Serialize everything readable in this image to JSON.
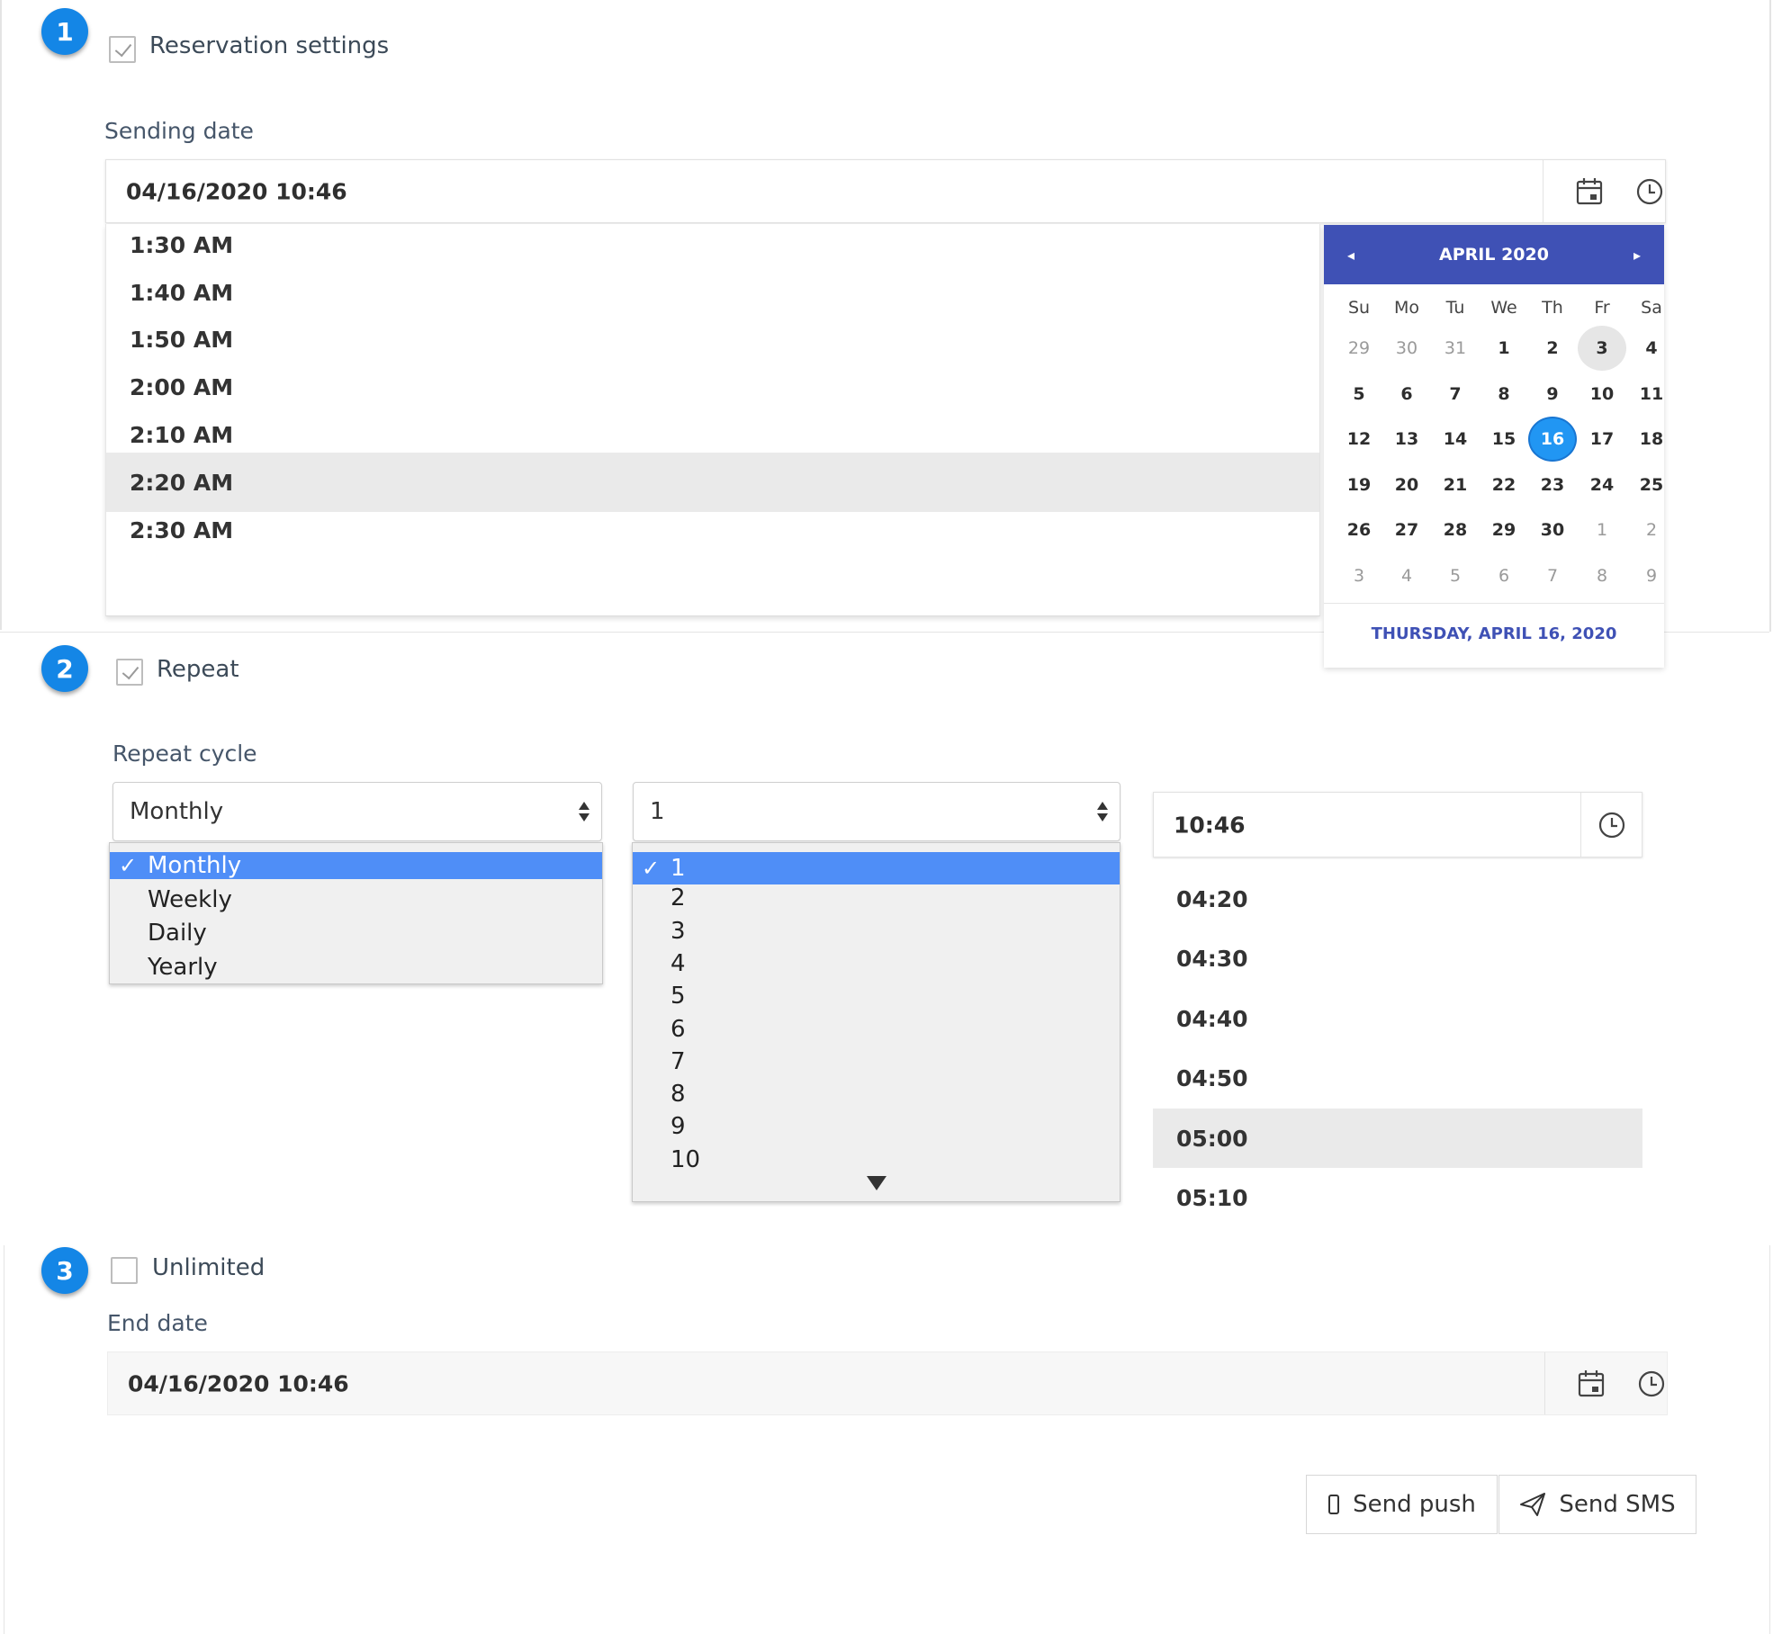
{
  "steps": {
    "one": "1",
    "two": "2",
    "three": "3"
  },
  "reservation": {
    "checkbox_label": "Reservation settings",
    "sending_date_label": "Sending date",
    "sending_date_value": "04/16/2020 10:46",
    "time_options": [
      "1:30 AM",
      "1:40 AM",
      "1:50 AM",
      "2:00 AM",
      "2:10 AM",
      "2:20 AM",
      "2:30 AM"
    ],
    "highlighted_time": "2:20 AM"
  },
  "calendar": {
    "month_title": "APRIL 2020",
    "prev_label": "◂",
    "next_label": "▸",
    "weekdays": [
      "Su",
      "Mo",
      "Tu",
      "We",
      "Th",
      "Fr",
      "Sa"
    ],
    "weeks": [
      [
        "29",
        "30",
        "31",
        "1",
        "2",
        "3",
        "4"
      ],
      [
        "5",
        "6",
        "7",
        "8",
        "9",
        "10",
        "11"
      ],
      [
        "12",
        "13",
        "14",
        "15",
        "16",
        "17",
        "18"
      ],
      [
        "19",
        "20",
        "21",
        "22",
        "23",
        "24",
        "25"
      ],
      [
        "26",
        "27",
        "28",
        "29",
        "30",
        "1",
        "2"
      ],
      [
        "3",
        "4",
        "5",
        "6",
        "7",
        "8",
        "9"
      ]
    ],
    "today": "3",
    "selected": "16",
    "footer": "THURSDAY, APRIL 16, 2020",
    "header_color": "#3f51b5",
    "selected_color": "#2196f3"
  },
  "repeat": {
    "checkbox_label": "Repeat",
    "cycle_label": "Repeat cycle",
    "cycle_value": "Monthly",
    "cycle_options": [
      "Monthly",
      "Weekly",
      "Daily",
      "Yearly"
    ],
    "interval_value": "1",
    "interval_options": [
      "1",
      "2",
      "3",
      "4",
      "5",
      "6",
      "7",
      "8",
      "9",
      "10"
    ],
    "time_value": "10:46",
    "time_options": [
      "04:20",
      "04:30",
      "04:40",
      "04:50",
      "05:00",
      "05:10"
    ],
    "highlighted_time": "05:00",
    "check_mark": "✓"
  },
  "end": {
    "checkbox_label": "Unlimited",
    "end_date_label": "End date",
    "end_date_value": "04/16/2020 10:46"
  },
  "actions": {
    "send_push": "Send push",
    "send_sms": "Send SMS"
  },
  "icons": {
    "calendar": "calendar-icon",
    "clock": "clock-icon",
    "mobile": "mobile-icon",
    "send": "paper-plane-icon"
  }
}
